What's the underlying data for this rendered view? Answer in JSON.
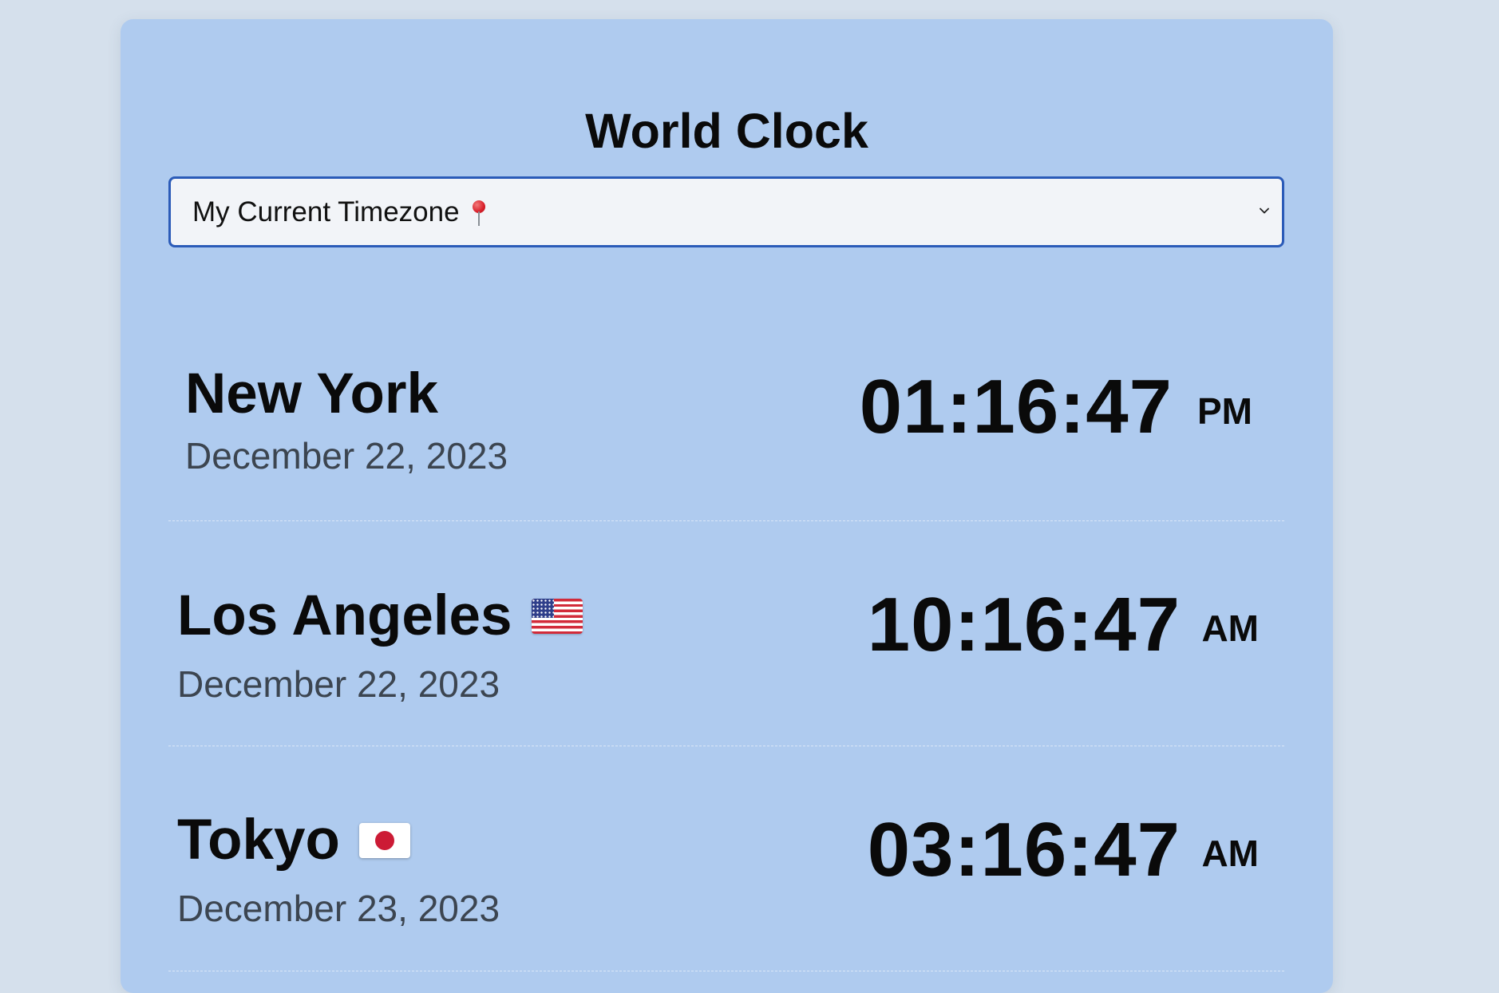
{
  "app": {
    "title": "World Clock"
  },
  "timezone_select": {
    "selected_label": "My Current Timezone"
  },
  "clocks": [
    {
      "city": "New York",
      "date": "December 22, 2023",
      "time": "01:16:47",
      "ampm": "PM",
      "flag": null
    },
    {
      "city": "Los Angeles",
      "date": "December 22, 2023",
      "time": "10:16:47",
      "ampm": "AM",
      "flag": "us-flag-icon"
    },
    {
      "city": "Tokyo",
      "date": "December 23, 2023",
      "time": "03:16:47",
      "ampm": "AM",
      "flag": "japan-flag-icon"
    }
  ],
  "colors": {
    "background": "#d5e0ec",
    "card": "#afcbef",
    "select_border": "#2b5bb8",
    "select_bg": "#f2f4f8"
  },
  "icons": {
    "select_pin": "round-pushpin-icon",
    "select_arrow": "chevron-down-icon"
  }
}
